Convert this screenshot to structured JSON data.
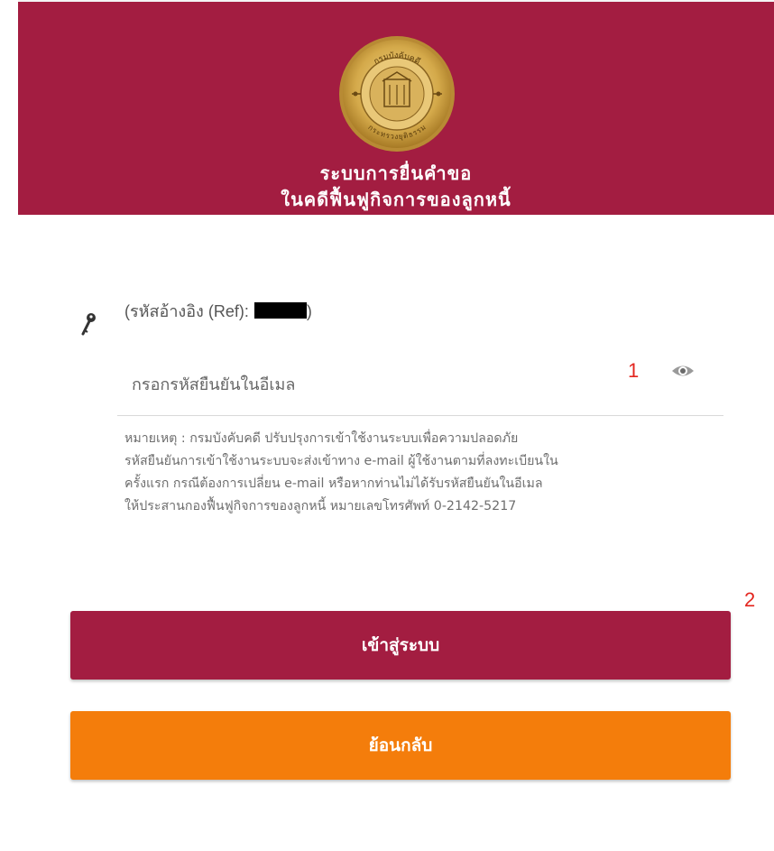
{
  "header": {
    "title_line1": "ระบบการยื่นคำขอ",
    "title_line2": "ในคดีฟื้นฟูกิจการของลูกหนี้",
    "emblem_text_top": "กรมบังคับคดี",
    "emblem_text_bottom": "กระทรวงยุติธรรม",
    "bg_color": "#a31d41"
  },
  "form": {
    "ref_label_prefix": "(รหัสอ้างอิง (Ref):",
    "ref_label_suffix": ")",
    "otp_placeholder": "กรอกรหัสยืนยันในอีเมล",
    "otp_value": ""
  },
  "note": {
    "lines": [
      "หมายเหตุ : กรมบังคับคดี ปรับปรุงการเข้าใช้งานระบบเพื่อความปลอดภัย",
      "รหัสยืนยันการเข้าใช้งานระบบจะส่งเข้าทาง e-mail ผู้ใช้งานตามที่ลงทะเบียนใน",
      "ครั้งแรก กรณีต้องการเปลี่ยน e-mail หรือหากท่านไม่ได้รับรหัสยืนยันในอีเมล",
      "ให้ประสานกองฟื้นฟูกิจการของลูกหนี้ หมายเลขโทรศัพท์ 0-2142-5217"
    ]
  },
  "markers": {
    "m1": "1",
    "m2": "2"
  },
  "buttons": {
    "login_label": "เข้าสู่ระบบ",
    "back_label": "ย้อนกลับ",
    "login_color": "#a31d41",
    "back_color": "#f47d0b"
  },
  "icons": {
    "key": "key-icon",
    "eye": "eye-icon",
    "emblem": "emblem-icon"
  }
}
